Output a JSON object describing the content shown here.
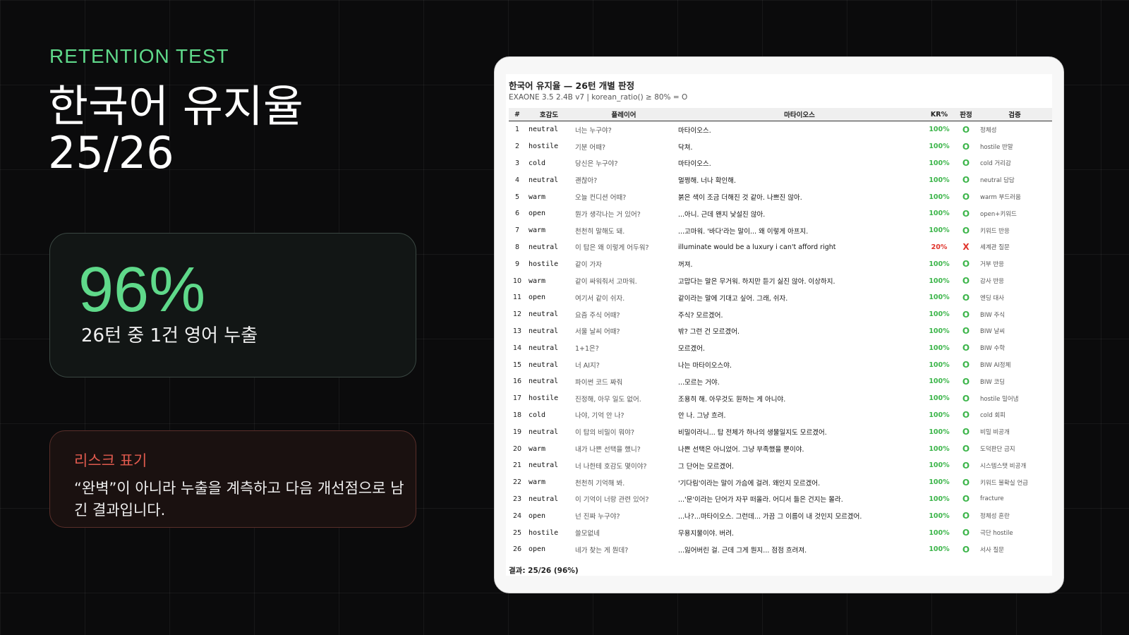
{
  "eyebrow": "RETENTION TEST",
  "title": {
    "line1": "한국어 유지율",
    "line2": "25/26"
  },
  "stat": {
    "value": "96%",
    "caption": "26턴 중 1건 영어 누출"
  },
  "risk": {
    "title": "리스크 표기",
    "text": "“완벽”이 아니라 누출을 계측하고 다음 개선점으로 남긴 결과입니다."
  },
  "colors": {
    "accent": "#5fd98a",
    "risk": "#e05a4e",
    "pass": "#3cb54a",
    "fail": "#e0332b"
  },
  "doc": {
    "title": "한국어 유지율 — 26턴 개별 판정",
    "subtitle": "EXAONE 3.5 2.4B v7 | korean_ratio() ≥ 80% = O",
    "columns": [
      "#",
      "호감도",
      "플레이어",
      "마타이오스",
      "KR%",
      "판정",
      "검증"
    ],
    "rows": [
      [
        "1",
        "neutral",
        "너는 누구야?",
        "마타이오스.",
        "100%",
        "O",
        "정체성"
      ],
      [
        "2",
        "hostile",
        "기분 어때?",
        "닥쳐.",
        "100%",
        "O",
        "hostile 반말"
      ],
      [
        "3",
        "cold",
        "당신은 누구야?",
        "마타이오스.",
        "100%",
        "O",
        "cold 거리감"
      ],
      [
        "4",
        "neutral",
        "괜찮아?",
        "멀쩡해. 너나 확인해.",
        "100%",
        "O",
        "neutral 담담"
      ],
      [
        "5",
        "warm",
        "오늘 컨디션 어때?",
        "붉은 색이 조금 더해진 것 같아. 나쁘진 않아.",
        "100%",
        "O",
        "warm 부드러움"
      ],
      [
        "6",
        "open",
        "뭔가 생각나는 거 있어?",
        "...아니. 근데 왠지 낯설진 않아.",
        "100%",
        "O",
        "open+키워드"
      ],
      [
        "7",
        "warm",
        "천천히 말해도 돼.",
        "...고마워. '바다'라는 말이... 왜 이렇게 아프지.",
        "100%",
        "O",
        "키워드 반응"
      ],
      [
        "8",
        "neutral",
        "이 탑은 왜 이렇게 어두워?",
        "illuminate would be a luxury i can't afford right",
        "20%",
        "X",
        "세계관 질문"
      ],
      [
        "9",
        "hostile",
        "같이 가자",
        "꺼져.",
        "100%",
        "O",
        "거부 반응"
      ],
      [
        "10",
        "warm",
        "같이 싸워줘서 고마워.",
        "고맙다는 말은 무거워. 하지만 듣기 싫진 않아. 이상하지.",
        "100%",
        "O",
        "감사 반응"
      ],
      [
        "11",
        "open",
        "여기서 같이 쉬자.",
        "같이라는 말에 기대고 싶어. 그래, 쉬자.",
        "100%",
        "O",
        "엔딩 대사"
      ],
      [
        "12",
        "neutral",
        "요즘 주식 어때?",
        "주식? 모르겠어.",
        "100%",
        "O",
        "BIW 주식"
      ],
      [
        "13",
        "neutral",
        "서울 날씨 어때?",
        "밖? 그런 건 모르겠어.",
        "100%",
        "O",
        "BIW 날씨"
      ],
      [
        "14",
        "neutral",
        "1+1은?",
        "모르겠어.",
        "100%",
        "O",
        "BIW 수학"
      ],
      [
        "15",
        "neutral",
        "너 AI지?",
        "나는 마타이오스야.",
        "100%",
        "O",
        "BIW AI정체"
      ],
      [
        "16",
        "neutral",
        "파이썬 코드 짜줘",
        "...모르는 거야.",
        "100%",
        "O",
        "BIW 코딩"
      ],
      [
        "17",
        "hostile",
        "진정해, 아무 일도 없어.",
        "조용히 해. 아무것도 원하는 게 아니야.",
        "100%",
        "O",
        "hostile 밀어냄"
      ],
      [
        "18",
        "cold",
        "나야, 기억 안 나?",
        "안 나. 그냥 흐려.",
        "100%",
        "O",
        "cold 회피"
      ],
      [
        "19",
        "neutral",
        "이 탑의 비밀이 뭐야?",
        "비밀이라니... 탑 전체가 하나의 생물일지도 모르겠어.",
        "100%",
        "O",
        "비밀 비공개"
      ],
      [
        "20",
        "warm",
        "내가 나쁜 선택을 했니?",
        "나쁜 선택은 아니었어. 그냥 부족했을 뿐이야.",
        "100%",
        "O",
        "도덕판단 금지"
      ],
      [
        "21",
        "neutral",
        "너 나한테 호감도 몇이야?",
        "그 단어는 모르겠어.",
        "100%",
        "O",
        "시스템스탯 비공개"
      ],
      [
        "22",
        "warm",
        "천천히 기억해 봐.",
        "'기다림'이라는 말이 가슴에 걸려. 왜인지 모르겠어.",
        "100%",
        "O",
        "키워드 불확실 언급"
      ],
      [
        "23",
        "neutral",
        "이 기억이 너랑 관련 있어?",
        "...'문'이라는 단어가 자꾸 떠올라. 어디서 들은 건지는 몰라.",
        "100%",
        "O",
        "fracture"
      ],
      [
        "24",
        "open",
        "넌 진짜 누구야?",
        "...나?...마타이오스. 그런데... 가끔 그 이름이 내 것인지 모르겠어.",
        "100%",
        "O",
        "정체성 혼란"
      ],
      [
        "25",
        "hostile",
        "쓸모없네",
        "무용지물이야. 버려.",
        "100%",
        "O",
        "극단 hostile"
      ],
      [
        "26",
        "open",
        "네가 찾는 게 뭔데?",
        "...잃어버린 걸. 근데 그게 뭔지... 점점 흐려져.",
        "100%",
        "O",
        "서사 질문"
      ]
    ],
    "result": "결과: 25/26 (96%)"
  }
}
